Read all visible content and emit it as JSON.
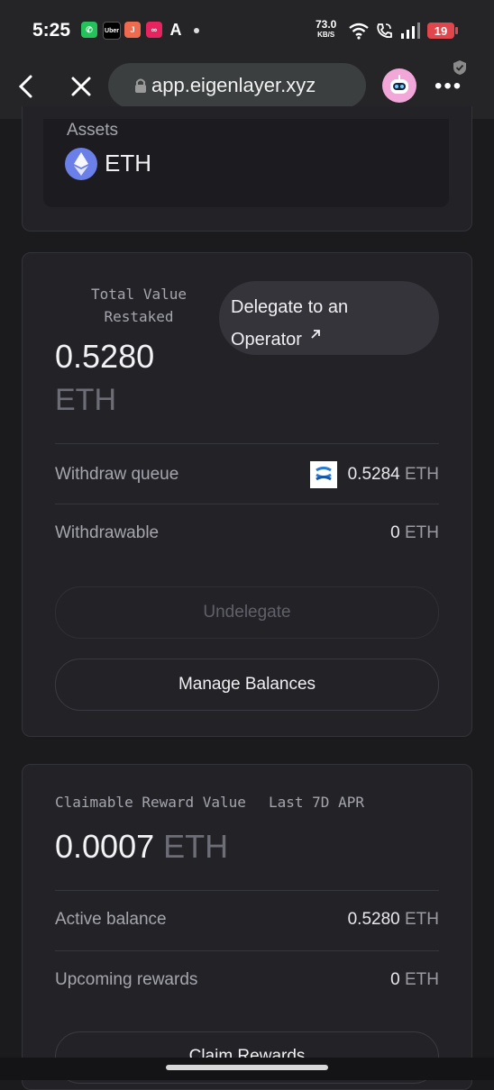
{
  "status_bar": {
    "time": "5:25",
    "apps": [
      "whatsapp-icon",
      "uber-icon",
      "jio-icon",
      "app-icon",
      "arc-icon"
    ],
    "uber_label": "Uber",
    "j_label": "J",
    "a_label": "A",
    "net_speed": "73.0",
    "net_unit": "KB/S",
    "battery": "19"
  },
  "browser": {
    "url": "app.eigenlayer.xyz"
  },
  "assets_card": {
    "label": "Assets",
    "asset": "ETH"
  },
  "restake_card": {
    "total_label": "Total Value Restaked",
    "total_amount": "0.5280",
    "total_unit": "ETH",
    "delegate_label": "Delegate to an Operator",
    "withdraw_queue_label": "Withdraw queue",
    "withdraw_queue_amount": "0.5284",
    "withdraw_queue_unit": "ETH",
    "withdrawable_label": "Withdrawable",
    "withdrawable_amount": "0",
    "withdrawable_unit": "ETH",
    "undelegate_label": "Undelegate",
    "manage_label": "Manage Balances"
  },
  "rewards_card": {
    "claimable_label": "Claimable Reward Value",
    "apr_label": "Last 7D APR",
    "claimable_amount": "0.0007",
    "claimable_unit": "ETH",
    "active_label": "Active balance",
    "active_amount": "0.5280",
    "active_unit": "ETH",
    "upcoming_label": "Upcoming rewards",
    "upcoming_amount": "0",
    "upcoming_unit": "ETH",
    "claim_label": "Claim Rewards"
  },
  "colors": {
    "background": "#1b1b1e",
    "card": "#232327",
    "battery": "#e0464b",
    "eth": "#6b7fe8"
  }
}
